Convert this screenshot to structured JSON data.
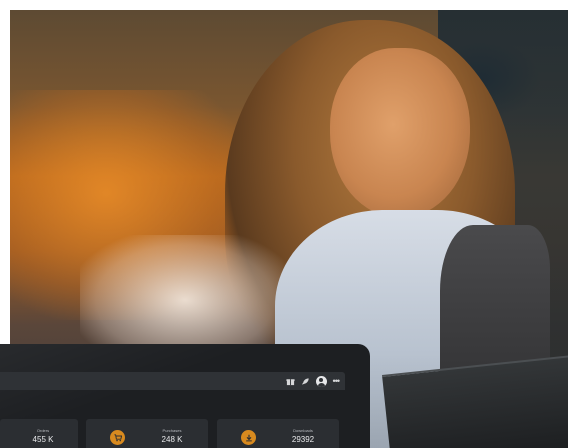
{
  "dashboard": {
    "toolbar": {
      "icons": [
        "gift-icon",
        "rocket-icon",
        "avatar-icon",
        "more-icon"
      ],
      "more_glyph": "•••"
    },
    "stats": [
      {
        "label": "Orders",
        "value": "455 K"
      },
      {
        "label": "Purchases",
        "value": "248 K",
        "icon": "cart-icon"
      },
      {
        "label": "Downloads",
        "value": "29392",
        "icon": "download-icon"
      }
    ],
    "accent_color": "#d88a1f",
    "background_color": "#1d1f22"
  }
}
